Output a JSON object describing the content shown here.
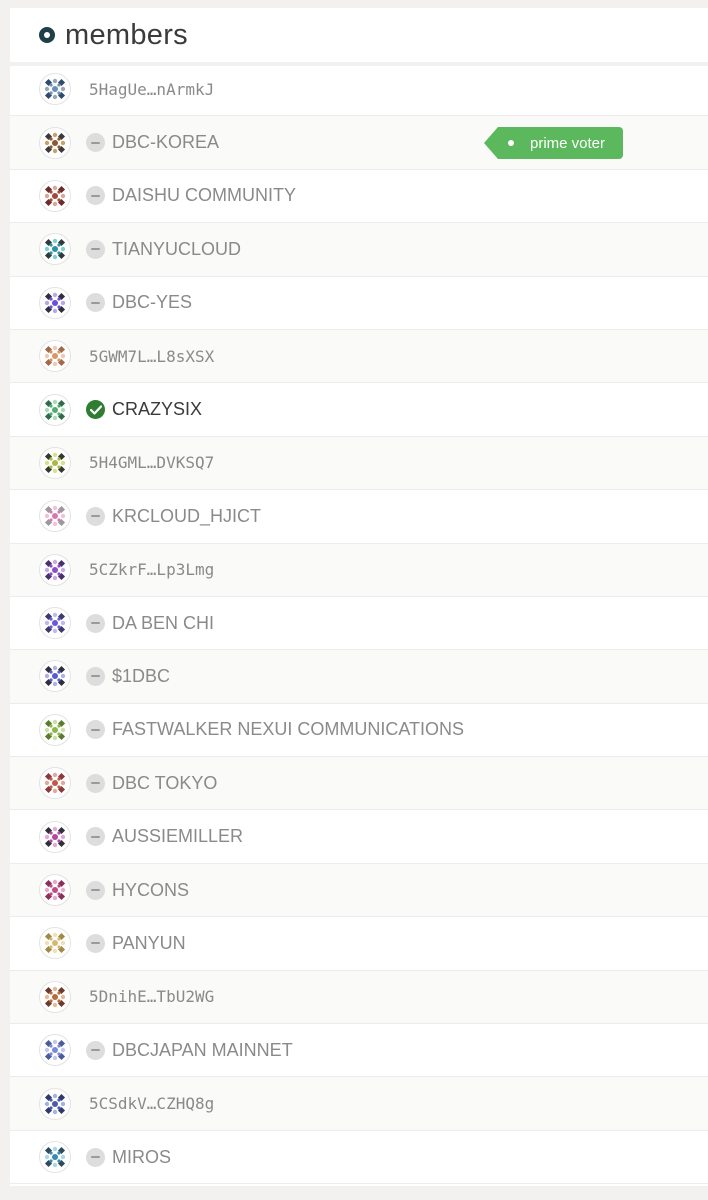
{
  "header": {
    "title": "members",
    "icon": "target-circle-icon",
    "icon_color": "#1f4048"
  },
  "members": [
    {
      "label": "5HagUe…nArmkJ",
      "kind": "address",
      "badge": "none",
      "colors": [
        "#9aa7b0",
        "#6a8fb8",
        "#2f4b6a"
      ]
    },
    {
      "label": "DBC-KOREA",
      "kind": "identity",
      "badge": "minus",
      "colors": [
        "#c9a06a",
        "#8a5a2f",
        "#3a3a3a"
      ],
      "tag": "prime voter"
    },
    {
      "label": "DAISHU COMMUNITY",
      "kind": "identity",
      "badge": "minus",
      "colors": [
        "#d9a59a",
        "#a04a3a",
        "#6b2b2b"
      ]
    },
    {
      "label": "TIANYUCLOUD",
      "kind": "identity",
      "badge": "minus",
      "colors": [
        "#7ecfd0",
        "#2f8fa0",
        "#2f3b3b"
      ]
    },
    {
      "label": "DBC-YES",
      "kind": "identity",
      "badge": "minus",
      "colors": [
        "#b7a8e6",
        "#6a4fd8",
        "#2f2f3a"
      ]
    },
    {
      "label": "5GWM7L…L8sXSX",
      "kind": "address",
      "badge": "none",
      "colors": [
        "#f0c8b0",
        "#d4966a",
        "#a06a4a"
      ]
    },
    {
      "label": "CRAZYSIX",
      "kind": "identity",
      "badge": "check",
      "colors": [
        "#a8dcb8",
        "#4fae6f",
        "#2f6b4a"
      ]
    },
    {
      "label": "5H4GML…DVKSQ7",
      "kind": "address",
      "badge": "none",
      "colors": [
        "#d8e08a",
        "#a8b84a",
        "#2f3b2f"
      ]
    },
    {
      "label": "KRCLOUD_HJICT",
      "kind": "identity",
      "badge": "minus",
      "colors": [
        "#f0c0dc",
        "#d47ab0",
        "#9a9a9a"
      ]
    },
    {
      "label": "5CZkrF…Lp3Lmg",
      "kind": "address",
      "badge": "none",
      "colors": [
        "#c8a8e8",
        "#8a4fc8",
        "#4a2f6b"
      ]
    },
    {
      "label": "DA BEN CHI",
      "kind": "identity",
      "badge": "minus",
      "colors": [
        "#c0b8f0",
        "#6a5ad8",
        "#3a3a6b"
      ]
    },
    {
      "label": "$1DBC",
      "kind": "identity",
      "badge": "minus",
      "colors": [
        "#b0b0e8",
        "#5a5ad0",
        "#2f2f3a"
      ]
    },
    {
      "label": "FASTWALKER NEXUI COMMUNICATIONS",
      "kind": "identity",
      "badge": "minus",
      "colors": [
        "#c8e0a0",
        "#8ab84a",
        "#5a7a2f"
      ]
    },
    {
      "label": "DBC TOKYO",
      "kind": "identity",
      "badge": "minus",
      "colors": [
        "#e0a8a0",
        "#c0584a",
        "#8a3a3a"
      ]
    },
    {
      "label": "AUSSIEMILLER",
      "kind": "identity",
      "badge": "minus",
      "colors": [
        "#e0a8d8",
        "#b04aa0",
        "#2f2f3a"
      ]
    },
    {
      "label": "HYCONS",
      "kind": "identity",
      "badge": "minus",
      "colors": [
        "#e8a8c8",
        "#c04a8a",
        "#8a2f5a"
      ]
    },
    {
      "label": "PANYUN",
      "kind": "identity",
      "badge": "minus",
      "colors": [
        "#f0e0b8",
        "#d8b870",
        "#a08a4a"
      ]
    },
    {
      "label": "5DnihE…TbU2WG",
      "kind": "address",
      "badge": "none",
      "colors": [
        "#e8b890",
        "#b86a3a",
        "#6b3a2f"
      ]
    },
    {
      "label": "DBCJAPAN MAINNET",
      "kind": "identity",
      "badge": "minus",
      "colors": [
        "#c0c8f0",
        "#7a8ad8",
        "#4a5a9a"
      ]
    },
    {
      "label": "5CSdkV…CZHQ8g",
      "kind": "address",
      "badge": "none",
      "colors": [
        "#a8b0e0",
        "#4a5ab0",
        "#2f3a6b"
      ]
    },
    {
      "label": "MIROS",
      "kind": "identity",
      "badge": "minus",
      "colors": [
        "#a8d8e8",
        "#3a8ab0",
        "#2f4a5a"
      ]
    }
  ]
}
